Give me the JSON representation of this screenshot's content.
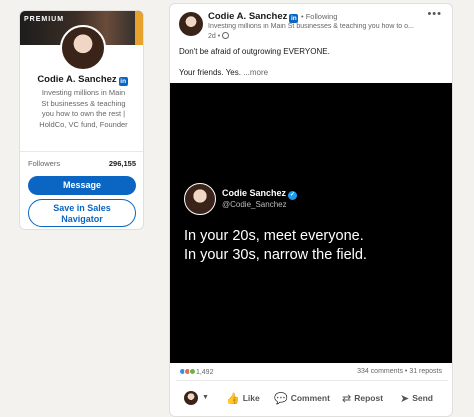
{
  "profile": {
    "badge": "PREMIUM",
    "name": "Codie A. Sanchez",
    "bio_lines": [
      "Investing millions in Main",
      "St businesses & teaching",
      "you how to own the rest |",
      "HoldCo, VC fund, Founder"
    ],
    "followers_label": "Followers",
    "followers_count": "296,155",
    "message_label": "Message",
    "save_label_lines": [
      "Save in Sales",
      "Navigator"
    ]
  },
  "post": {
    "author": "Codie A. Sanchez",
    "following": "• Following",
    "headline": "Investing millions in Main St businesses & teaching you how to o...",
    "time": "2d •",
    "more_menu": "•••",
    "text_line1": "Don't be afraid of outgrowing EVERYONE.",
    "text_line2": "Your friends. Yes.",
    "see_more": " ...more",
    "tweet": {
      "name": "Codie Sanchez",
      "handle": "@Codie_Sanchez",
      "lines": [
        "In your 20s, meet everyone.",
        "In your 30s, narrow the field."
      ]
    },
    "reaction_count": "1,492",
    "comments_reposts": "334 comments • 31 reposts",
    "actions": {
      "like": "Like",
      "comment": "Comment",
      "repost": "Repost",
      "send": "Send"
    }
  },
  "icons": {
    "linkedin": "in",
    "verified": "✓",
    "caret": "▼",
    "like": "👍",
    "comment": "💬",
    "repost": "⇄",
    "send": "➤"
  },
  "colors": {
    "accent": "#0a66c2",
    "verified": "#1d9bf0",
    "media_bg": "#000000"
  }
}
